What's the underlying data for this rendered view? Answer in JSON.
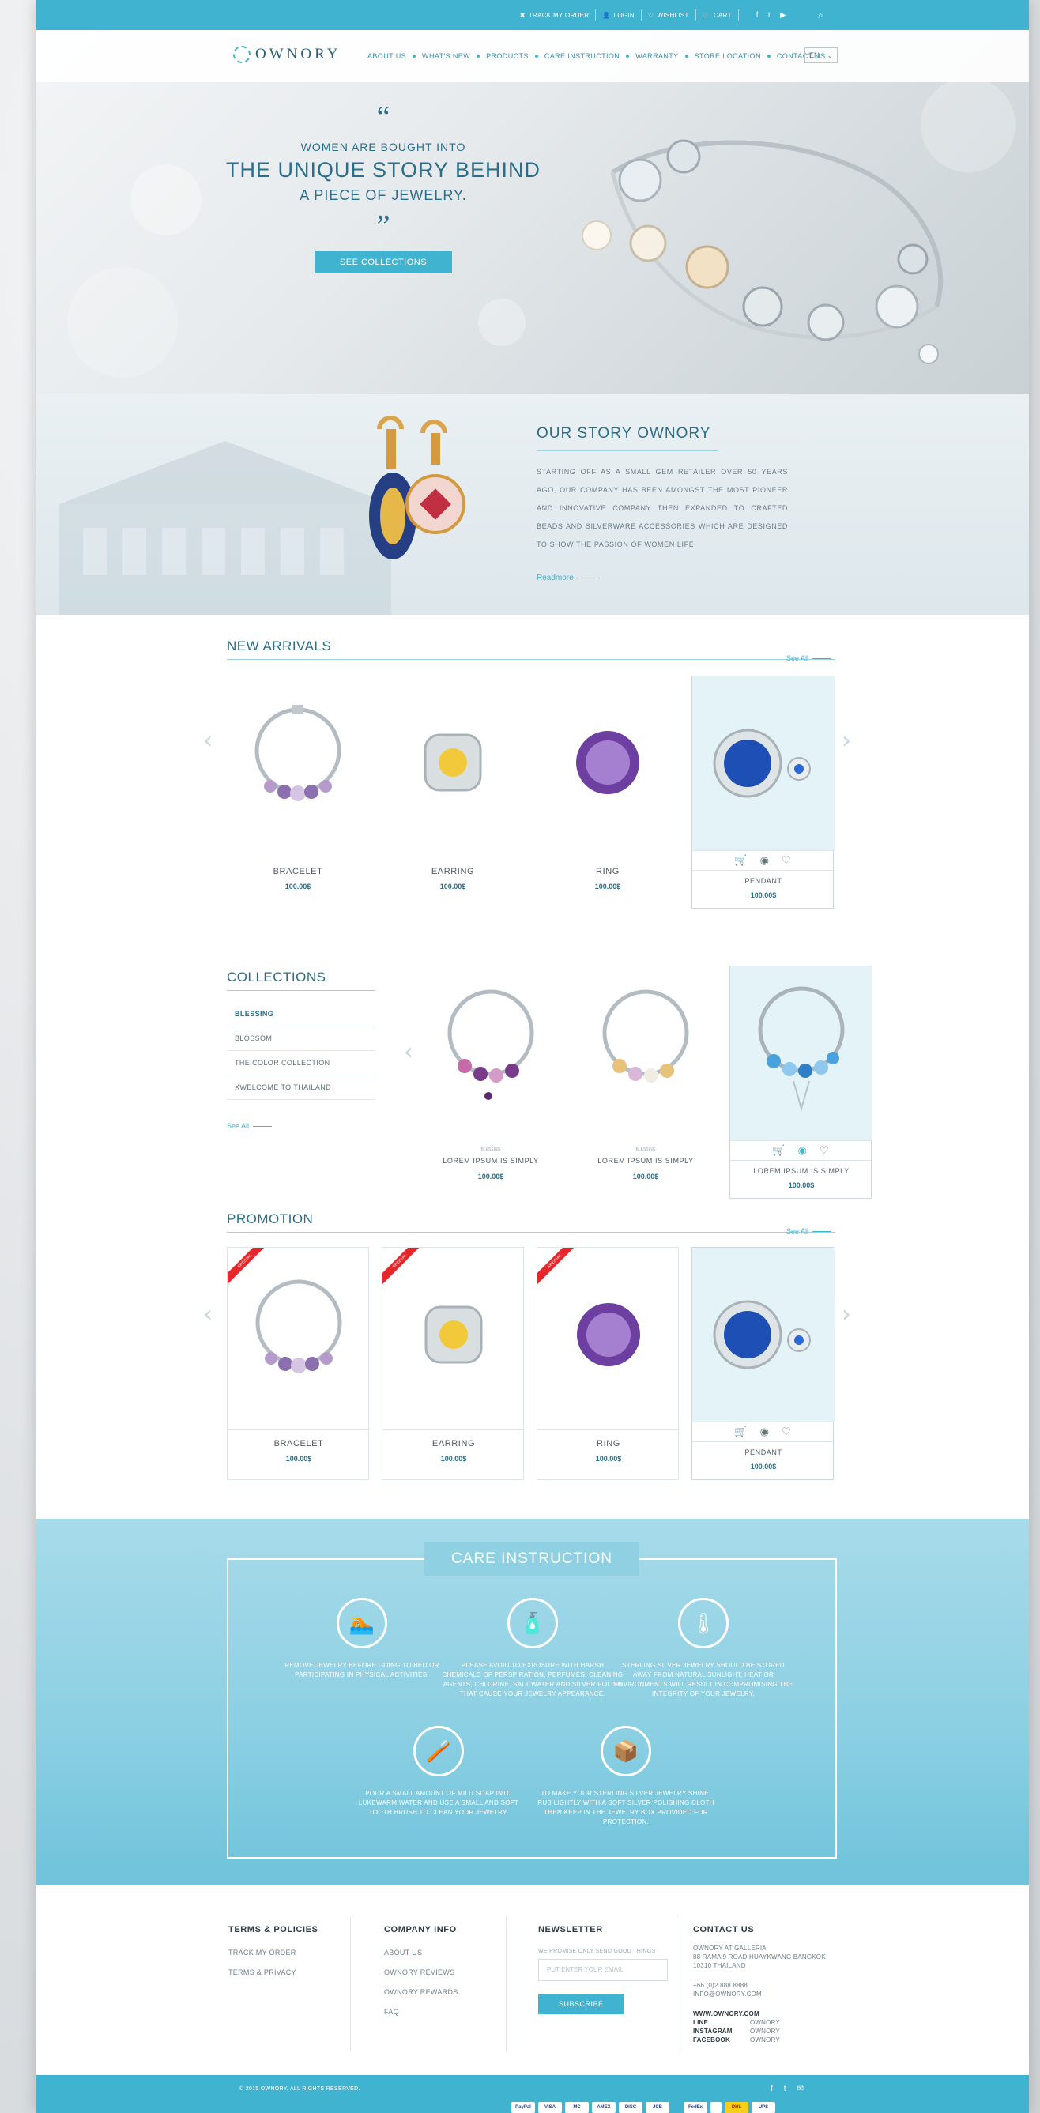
{
  "topbar": {
    "track": "TRACK MY ORDER",
    "login": "LOGIN",
    "wishlist": "WISHLIST",
    "cart": "CART",
    "social": [
      "f",
      "t",
      "▶"
    ]
  },
  "brand": {
    "name": "OWNORY"
  },
  "nav": {
    "items": [
      "ABOUT US",
      "WHAT'S NEW",
      "PRODUCTS",
      "CARE INSTRUCTION",
      "WARRANTY",
      "STORE LOCATION",
      "CONTACT US"
    ],
    "lang": "EN"
  },
  "hero": {
    "quote_open": "“",
    "line1": "WOMEN ARE BOUGHT INTO",
    "line2": "THE UNIQUE STORY BEHIND",
    "line3": "A PIECE OF JEWELRY.",
    "quote_close": "”",
    "button": "SEE COLLECTIONS"
  },
  "story": {
    "title": "OUR STORY OWNORY",
    "body": "STARTING OFF AS A SMALL GEM RETAILER OVER 50 YEARS AGO, OUR COMPANY HAS BEEN AMONGST THE MOST PIONEER AND INNOVATIVE COMPANY THEN EXPANDED TO CRAFTED BEADS AND SILVERWARE ACCESSORIES WHICH ARE DESIGNED TO SHOW THE PASSION OF WOMEN LIFE.",
    "readmore": "Readmore"
  },
  "new_arrivals": {
    "title": "NEW ARRIVALS",
    "see_all": "See All",
    "items": [
      {
        "name": "BRACELET",
        "price": "100.00$"
      },
      {
        "name": "EARRING",
        "price": "100.00$"
      },
      {
        "name": "RING",
        "price": "100.00$"
      },
      {
        "name": "PENDANT",
        "price": "100.00$"
      }
    ]
  },
  "collections": {
    "title": "COLLECTIONS",
    "list": [
      "BLESSING",
      "BLOSSOM",
      "THE COLOR COLLECTION",
      "XWELCOME TO THAILAND"
    ],
    "see_all": "See All",
    "items": [
      {
        "tag": "BLESSING",
        "name": "LOREM IPSUM IS SIMPLY",
        "price": "100.00$"
      },
      {
        "tag": "BLESSING",
        "name": "LOREM IPSUM IS SIMPLY",
        "price": "100.00$"
      },
      {
        "tag": "",
        "name": "LOREM IPSUM IS SIMPLY",
        "price": "100.00$"
      }
    ]
  },
  "promotion": {
    "title": "PROMOTION",
    "see_all": "See All",
    "ribbon": "SPECIAL",
    "items": [
      {
        "name": "BRACELET",
        "price": "100.00$"
      },
      {
        "name": "EARRING",
        "price": "100.00$"
      },
      {
        "name": "RING",
        "price": "100.00$"
      },
      {
        "name": "PENDANT",
        "price": "100.00$"
      }
    ]
  },
  "care": {
    "title": "CARE INSTRUCTION",
    "items": [
      {
        "icon": "swimmer-icon",
        "glyph": "🏊",
        "text": "REMOVE JEWELRY BEFORE GOING TO BED OR PARTICIPATING IN PHYSICAL ACTIVITIES."
      },
      {
        "icon": "spray-icon",
        "glyph": "🧴",
        "text": "PLEASE AVOID TO EXPOSURE WITH HARSH CHEMICALS OF PERSPIRATION, PERFUMES, CLEANING AGENTS, CHLORINE, SALT WATER AND SILVER POLISH THAT CAUSE YOUR JEWELRY APPEARANCE."
      },
      {
        "icon": "thermometer-icon",
        "glyph": "🌡",
        "text": "STERLING SILVER JEWELRY SHOULD BE STORED AWAY FROM NATURAL SUNLIGHT, HEAT OR ENVIRONMENTS WILL RESULT IN COMPROMISING THE INTEGRITY OF YOUR JEWELRY."
      },
      {
        "icon": "brush-icon",
        "glyph": "🪥",
        "text": "POUR A SMALL AMOUNT OF MILD SOAP INTO LUKEWARM WATER AND USE A SMALL AND SOFT TOOTH BRUSH TO CLEAN YOUR JEWELRY."
      },
      {
        "icon": "box-icon",
        "glyph": "📦",
        "text": "TO MAKE YOUR STERLING SILVER JEWELRY SHINE, RUB LIGHTLY WITH A SOFT SILVER POLISHING CLOTH THEN KEEP IN THE JEWELRY BOX PROVIDED FOR PROTECTION."
      }
    ]
  },
  "footer": {
    "terms": {
      "title": "TERMS & POLICIES",
      "links": [
        "TRACK MY ORDER",
        "TERMS & PRIVACY"
      ]
    },
    "company": {
      "title": "COMPANY INFO",
      "links": [
        "ABOUT US",
        "OWNORY REVIEWS",
        "OWNORY REWARDS",
        "FAQ"
      ]
    },
    "newsletter": {
      "title": "NEWSLETTER",
      "note": "WE PROMISE ONLY SEND GOOD THINGS",
      "placeholder": "PUT ENTER YOUR EMAIL",
      "button": "SUBSCRIBE"
    },
    "contact": {
      "title": "CONTACT US",
      "addr1": "OWNORY AT GALLERIA",
      "addr2": "88 RAMA 9 ROAD HUAYKWANG BANGKOK",
      "addr3": "10310 THAILAND",
      "phone": "+66 (0)2 888 8888",
      "email": "INFO@OWNORY.COM",
      "web": "WWW.OWNORY.COM",
      "social": [
        {
          "k": "LINE",
          "v": "OWNORY"
        },
        {
          "k": "INSTAGRAM",
          "v": "OWNORY"
        },
        {
          "k": "FACEBOOK",
          "v": "OWNORY"
        }
      ]
    },
    "copyright": "© 2015 OWNORY. ALL RIGHTS RESERVED.",
    "social": [
      "f",
      "t",
      "✉"
    ],
    "payments": [
      "PayPal",
      "VISA",
      "MC",
      "AMEX",
      "DISC",
      "JCB",
      "",
      "FedEx",
      "",
      "DHL",
      "UPS"
    ]
  },
  "colors": {
    "accent": "#3fb3cf",
    "heading": "#2a6e8a",
    "care_bg": "#8dd0e3",
    "ribbon": "#e5262a"
  }
}
